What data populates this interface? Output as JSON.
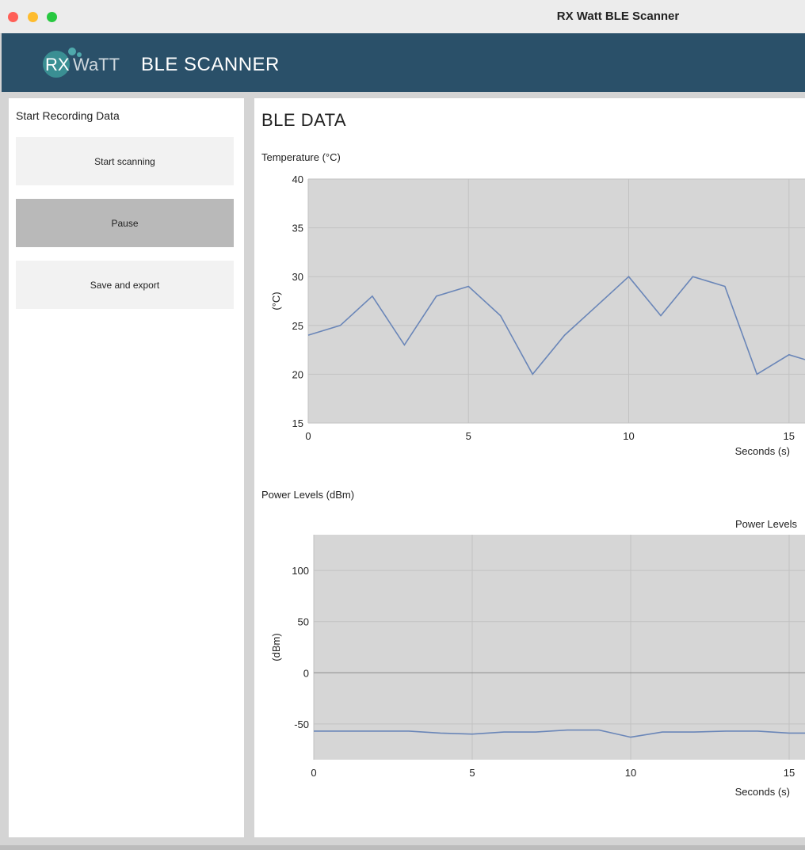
{
  "window": {
    "title": "RX Watt BLE Scanner"
  },
  "header": {
    "logo_rx": "RX",
    "logo_watt": "WaTT",
    "app_title": "BLE SCANNER"
  },
  "sidebar": {
    "title": "Start Recording Data",
    "buttons": [
      {
        "label": "Start scanning",
        "state": "normal"
      },
      {
        "label": "Pause",
        "state": "pressed"
      },
      {
        "label": "Save and export",
        "state": "normal"
      }
    ]
  },
  "main": {
    "title": "BLE DATA",
    "temperature_section": "Temperature (°C)",
    "power_section": "Power Levels (dBm)"
  },
  "colors": {
    "header_bg": "#2a5069",
    "plot_bg": "#d6d6d6",
    "line": "#6a86b8",
    "pressed_btn": "#b9b9b9"
  },
  "chart_data": [
    {
      "type": "line",
      "title": "",
      "xlabel": "Seconds (s)",
      "ylabel": "(°C)",
      "xlim": [
        0,
        15.5
      ],
      "ylim": [
        15,
        40
      ],
      "xticks": [
        0,
        5,
        10,
        15
      ],
      "yticks": [
        15,
        20,
        25,
        30,
        35,
        40
      ],
      "grid": true,
      "series": [
        {
          "x": [
            0,
            1,
            2,
            3,
            4,
            5,
            6,
            7,
            8,
            9,
            10,
            11,
            12,
            13,
            14,
            15,
            15.5
          ],
          "values": [
            24,
            25,
            28,
            23,
            28,
            29,
            26,
            20,
            24,
            27,
            30,
            26,
            30,
            29,
            20,
            22,
            21.5
          ]
        }
      ]
    },
    {
      "type": "line",
      "title": "Power Levels",
      "xlabel": "Seconds (s)",
      "ylabel": "(dBm)",
      "xlim": [
        0,
        15.5
      ],
      "ylim": [
        -85,
        135
      ],
      "xticks": [
        0,
        5,
        10,
        15
      ],
      "yticks": [
        -50,
        0,
        50,
        100
      ],
      "grid": true,
      "series": [
        {
          "x": [
            0,
            1,
            2,
            3,
            4,
            5,
            6,
            7,
            8,
            9,
            10,
            11,
            12,
            13,
            14,
            15,
            15.5
          ],
          "values": [
            -57,
            -57,
            -57,
            -57,
            -59,
            -60,
            -58,
            -58,
            -56,
            -56,
            -63,
            -58,
            -58,
            -57,
            -57,
            -59,
            -59
          ]
        }
      ]
    }
  ]
}
